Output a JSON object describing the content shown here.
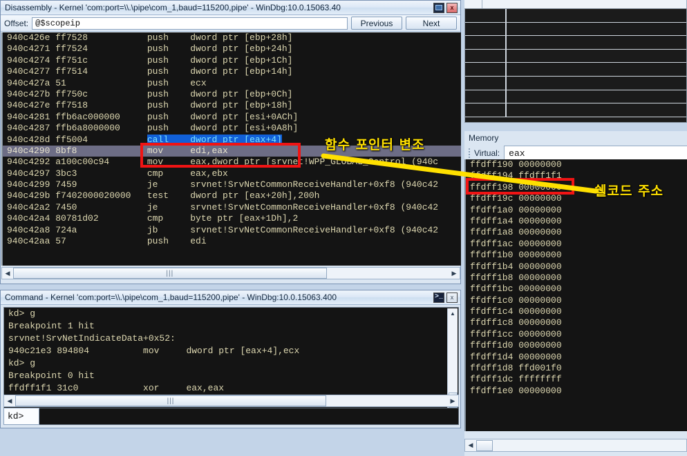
{
  "disassembly": {
    "title": "Disassembly - Kernel 'com:port=\\\\.\\pipe\\com_1,baud=115200,pipe' - WinDbg:10.0.15063.40",
    "buttons": {
      "restore": "restore",
      "close": "x"
    },
    "toolbar": {
      "offset_label": "Offset:",
      "offset_value": "@$scopeip",
      "previous_label": "Previous",
      "next_label": "Next"
    },
    "lines": [
      {
        "addr": "940c426e",
        "bytes": "ff7528",
        "mn": "push",
        "ops": "dword ptr [ebp+28h]"
      },
      {
        "addr": "940c4271",
        "bytes": "ff7524",
        "mn": "push",
        "ops": "dword ptr [ebp+24h]"
      },
      {
        "addr": "940c4274",
        "bytes": "ff751c",
        "mn": "push",
        "ops": "dword ptr [ebp+1Ch]"
      },
      {
        "addr": "940c4277",
        "bytes": "ff7514",
        "mn": "push",
        "ops": "dword ptr [ebp+14h]"
      },
      {
        "addr": "940c427a",
        "bytes": "51",
        "mn": "push",
        "ops": "ecx"
      },
      {
        "addr": "940c427b",
        "bytes": "ff750c",
        "mn": "push",
        "ops": "dword ptr [ebp+0Ch]"
      },
      {
        "addr": "940c427e",
        "bytes": "ff7518",
        "mn": "push",
        "ops": "dword ptr [ebp+18h]"
      },
      {
        "addr": "940c4281",
        "bytes": "ffb6ac000000",
        "mn": "push",
        "ops": "dword ptr [esi+0ACh]"
      },
      {
        "addr": "940c4287",
        "bytes": "ffb6a8000000",
        "mn": "push",
        "ops": "dword ptr [esi+0A8h]"
      },
      {
        "addr": "940c428d",
        "bytes": "ff5004",
        "mn": "call",
        "ops": "dword ptr [eax+4]",
        "selected": true
      },
      {
        "addr": "940c4290",
        "bytes": "8bf8",
        "mn": "mov",
        "ops": "edi,eax",
        "current": true
      },
      {
        "addr": "940c4292",
        "bytes": "a100c00c94",
        "mn": "mov",
        "ops": "eax,dword ptr [srvnet!WPP_GLOBAL_Control (940c"
      },
      {
        "addr": "940c4297",
        "bytes": "3bc3",
        "mn": "cmp",
        "ops": "eax,ebx"
      },
      {
        "addr": "940c4299",
        "bytes": "7459",
        "mn": "je",
        "ops": "srvnet!SrvNetCommonReceiveHandler+0xf8 (940c42"
      },
      {
        "addr": "940c429b",
        "bytes": "f7402000020000",
        "mn": "test",
        "ops": "dword ptr [eax+20h],200h"
      },
      {
        "addr": "940c42a2",
        "bytes": "7450",
        "mn": "je",
        "ops": "srvnet!SrvNetCommonReceiveHandler+0xf8 (940c42"
      },
      {
        "addr": "940c42a4",
        "bytes": "80781d02",
        "mn": "cmp",
        "ops": "byte ptr [eax+1Dh],2"
      },
      {
        "addr": "940c42a8",
        "bytes": "724a",
        "mn": "jb",
        "ops": "srvnet!SrvNetCommonReceiveHandler+0xf8 (940c42"
      },
      {
        "addr": "940c42aa",
        "bytes": "57",
        "mn": "push",
        "ops": "edi"
      }
    ]
  },
  "command": {
    "title": "Command - Kernel 'com:port=\\\\.\\pipe\\com_1,baud=115200,pipe' - WinDbg:10.0.15063.400",
    "buttons": {
      "console": ">_",
      "close": "x"
    },
    "output": [
      "kd> g",
      "Breakpoint 1 hit",
      "srvnet!SrvNetIndicateData+0x52:",
      "940c21e3 894804          mov     dword ptr [eax+4],ecx",
      "kd> g",
      "Breakpoint 0 hit",
      "ffdff1f1 31c0            xor     eax,eax"
    ],
    "prompt_label": "kd>",
    "prompt_value": ""
  },
  "memory": {
    "title": "Memory",
    "address_label": "Virtual:",
    "address_value": "eax",
    "rows": [
      {
        "addr": "ffdff190",
        "value": "00000000"
      },
      {
        "addr": "ffdff194",
        "value": "ffdff1f1",
        "highlighted": true
      },
      {
        "addr": "ffdff198",
        "value": "00000000"
      },
      {
        "addr": "ffdff19c",
        "value": "00000000"
      },
      {
        "addr": "ffdff1a0",
        "value": "00000000"
      },
      {
        "addr": "ffdff1a4",
        "value": "00000000"
      },
      {
        "addr": "ffdff1a8",
        "value": "00000000"
      },
      {
        "addr": "ffdff1ac",
        "value": "00000000"
      },
      {
        "addr": "ffdff1b0",
        "value": "00000000"
      },
      {
        "addr": "ffdff1b4",
        "value": "00000000"
      },
      {
        "addr": "ffdff1b8",
        "value": "00000000"
      },
      {
        "addr": "ffdff1bc",
        "value": "00000000"
      },
      {
        "addr": "ffdff1c0",
        "value": "00000000"
      },
      {
        "addr": "ffdff1c4",
        "value": "00000000"
      },
      {
        "addr": "ffdff1c8",
        "value": "00000000"
      },
      {
        "addr": "ffdff1cc",
        "value": "00000000"
      },
      {
        "addr": "ffdff1d0",
        "value": "00000000"
      },
      {
        "addr": "ffdff1d4",
        "value": "00000000"
      },
      {
        "addr": "ffdff1d8",
        "value": "ffd001f0"
      },
      {
        "addr": "ffdff1dc",
        "value": "ffffffff"
      },
      {
        "addr": "ffdff1e0",
        "value": "00000000"
      }
    ]
  },
  "annotations": {
    "function_pointer": "함수 포인터 변조",
    "shellcode_address": "쉘코드 주소",
    "arrow_color": "#ffe000",
    "box_color": "#f01414"
  },
  "colors": {
    "terminal_bg": "#141414",
    "terminal_fg": "#ddd7b0",
    "selection_bg": "#1160d8",
    "selection_fg": "#7fe3ff",
    "current_line_bg": "#6d6d85",
    "window_chrome": "#dbe6f2",
    "desktop": "#c3d4e8"
  }
}
